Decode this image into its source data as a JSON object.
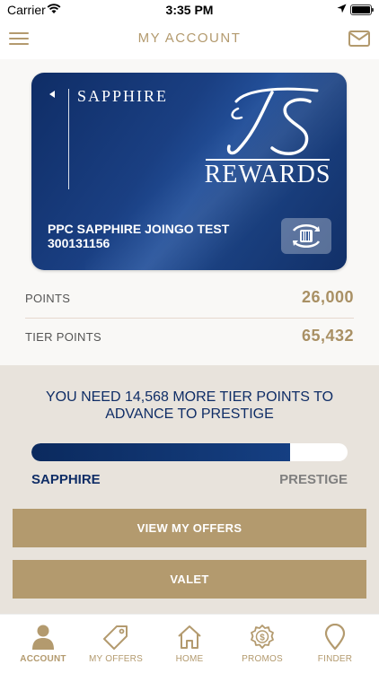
{
  "status_bar": {
    "carrier": "Carrier",
    "time": "3:35 PM"
  },
  "nav": {
    "title": "MY ACCOUNT"
  },
  "card": {
    "tier_name": "SAPPHIRE",
    "program": "REWARDS",
    "holder_name": "PPC SAPPHIRE JOINGO TEST",
    "account_number": "300131156"
  },
  "points": [
    {
      "label": "POINTS",
      "value": "26,000"
    },
    {
      "label": "TIER POINTS",
      "value": "65,432"
    }
  ],
  "tier": {
    "message": "YOU NEED 14,568 MORE TIER POINTS TO ADVANCE TO PRESTIGE",
    "current": "SAPPHIRE",
    "next": "PRESTIGE",
    "progress": 0.818
  },
  "buttons": {
    "offers": "VIEW MY OFFERS",
    "valet": "VALET"
  },
  "tabs": [
    {
      "label": "ACCOUNT",
      "icon": "person-icon",
      "active": true
    },
    {
      "label": "MY OFFERS",
      "icon": "tag-icon",
      "active": false
    },
    {
      "label": "HOME",
      "icon": "home-icon",
      "active": false
    },
    {
      "label": "PROMOS",
      "icon": "promo-badge-icon",
      "active": false
    },
    {
      "label": "FINDER",
      "icon": "map-pin-icon",
      "active": false
    }
  ],
  "colors": {
    "gold": "#b39a6e",
    "navy": "#0f2d66",
    "card_blue": "#1a3f82",
    "tier_bg": "#e8e3dc"
  }
}
